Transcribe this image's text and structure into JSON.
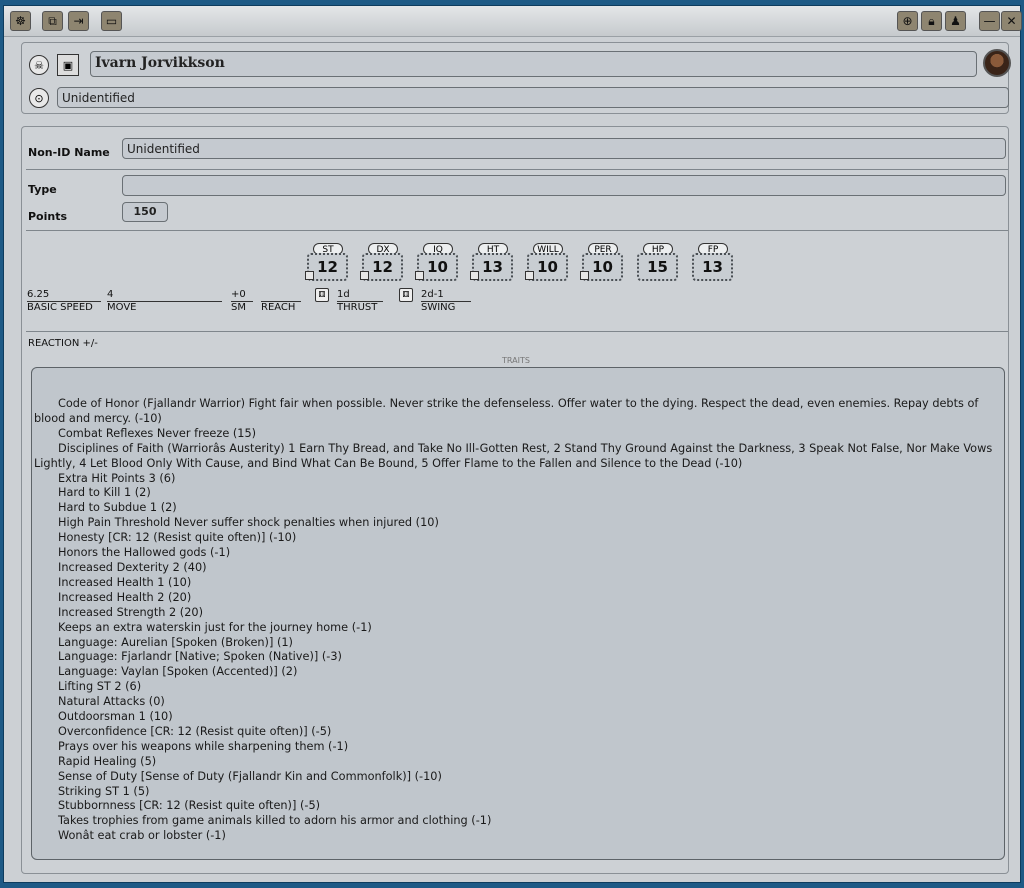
{
  "character": {
    "name": "Ivarn Jorvikkson",
    "identity": "Unidentified"
  },
  "fields": {
    "nonid_label": "Non-ID Name",
    "nonid_value": "Unidentified",
    "type_label": "Type",
    "type_value": "",
    "points_label": "Points",
    "points_value": "150"
  },
  "stats": [
    {
      "label": "ST",
      "value": "12"
    },
    {
      "label": "DX",
      "value": "12"
    },
    {
      "label": "IQ",
      "value": "10"
    },
    {
      "label": "HT",
      "value": "13"
    },
    {
      "label": "WILL",
      "value": "10"
    },
    {
      "label": "PER",
      "value": "10"
    },
    {
      "label": "HP",
      "value": "15"
    },
    {
      "label": "FP",
      "value": "13"
    }
  ],
  "derived": {
    "basic_speed_value": "6.25",
    "basic_speed_label": "BASIC SPEED",
    "move_value": "4",
    "move_label": "MOVE",
    "sm_value": "+0",
    "sm_label": "SM",
    "reach_value": "",
    "reach_label": "REACH",
    "thrust_value": "1d",
    "thrust_label": "THRUST",
    "swing_value": "2d-1",
    "swing_label": "SWING"
  },
  "reaction_label": "REACTION +/-",
  "traits_header": "TRAITS",
  "traits": [
    "Code of Honor (Fjallandr Warrior)  Fight fair when possible. Never strike the defenseless. Offer water to the dying. Respect the dead, even enemies. Repay debts of blood and mercy. (-10)",
    "Combat Reflexes  Never freeze (15)",
    "Disciplines of Faith (Warriorâs Austerity)  1 Earn Thy Bread, and Take No Ill-Gotten Rest, 2 Stand Thy Ground Against the Darkness, 3 Speak Not False, Nor Make Vows Lightly, 4 Let Blood Only With Cause, and Bind What Can Be Bound, 5 Offer Flame to the Fallen and Silence to the Dead (-10)",
    "Extra Hit Points 3  (6)",
    "Hard to Kill 1  (2)",
    "Hard to Subdue 1  (2)",
    "High Pain Threshold  Never suffer shock penalties when injured (10)",
    "Honesty  [CR: 12 (Resist quite often)]  (-10)",
    "Honors the Hallowed gods  (-1)",
    "Increased Dexterity 2  (40)",
    "Increased Health 1  (10)",
    "Increased Health 2  (20)",
    "Increased Strength 2  (20)",
    "Keeps an extra waterskin just for the journey home  (-1)",
    "Language: Aurelian  [Spoken (Broken)]  (1)",
    "Language: Fjarlandr  [Native; Spoken (Native)]  (-3)",
    "Language: Vaylan  [Spoken (Accented)]  (2)",
    "Lifting ST 2  (6)",
    "Natural Attacks  (0)",
    "Outdoorsman 1  (10)",
    "Overconfidence  [CR: 12 (Resist quite often)]  (-5)",
    "Prays over his weapons while sharpening them  (-1)",
    "Rapid Healing  (5)",
    "Sense of Duty  [Sense of Duty (Fjallandr Kin and Commonfolk)]  (-10)",
    "Striking ST 1  (5)",
    "Stubbornness  [CR: 12 (Resist quite often)]  (-5)",
    "Takes trophies from game animals killed to adorn his armor and clothing  (-1)",
    "Wonât eat crab or lobster  (-1)"
  ]
}
